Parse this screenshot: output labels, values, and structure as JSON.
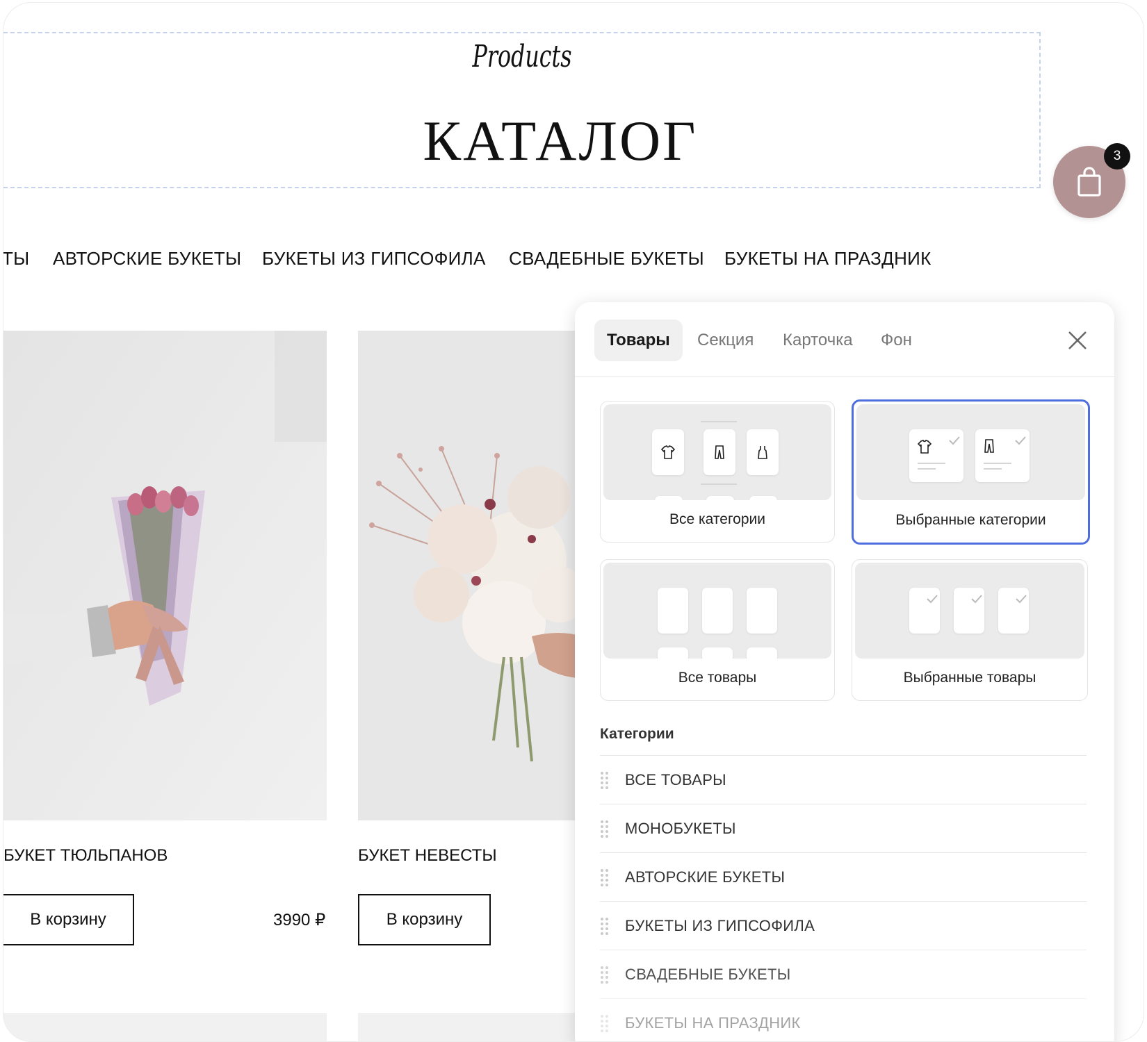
{
  "header": {
    "subtitle": "Products",
    "title": "КАТАЛОГ"
  },
  "cart": {
    "count": "3",
    "icon": "shopping-bag-icon",
    "color": "#b39293"
  },
  "category_nav": [
    "ТЫ",
    "АВТОРСКИЕ БУКЕТЫ",
    "БУКЕТЫ ИЗ ГИПСОФИЛА",
    "СВАДЕБНЫЕ БУКЕТЫ",
    "БУКЕТЫ НА ПРАЗДНИК"
  ],
  "products": [
    {
      "name": "БУКЕТ ТЮЛЬПАНОВ",
      "button": "В корзину",
      "price": "3990 ₽"
    },
    {
      "name": "БУКЕТ НЕВЕСТЫ",
      "button": "В корзину"
    }
  ],
  "panel": {
    "tabs": [
      "Товары",
      "Секция",
      "Карточка",
      "Фон"
    ],
    "active_tab": "Товары",
    "options": [
      {
        "label": "Все категории",
        "selected": false
      },
      {
        "label": "Выбранные категории",
        "selected": true
      },
      {
        "label": "Все товары",
        "selected": false
      },
      {
        "label": "Выбранные товары",
        "selected": false
      }
    ],
    "section_title": "Категории",
    "categories": [
      "ВСЕ ТОВАРЫ",
      "МОНОБУКЕТЫ",
      "АВТОРСКИЕ БУКЕТЫ",
      "БУКЕТЫ ИЗ ГИПСОФИЛА",
      "СВАДЕБНЫЕ БУКЕТЫ",
      "БУКЕТЫ НА ПРАЗДНИК"
    ],
    "accent": "#4f6ede"
  }
}
